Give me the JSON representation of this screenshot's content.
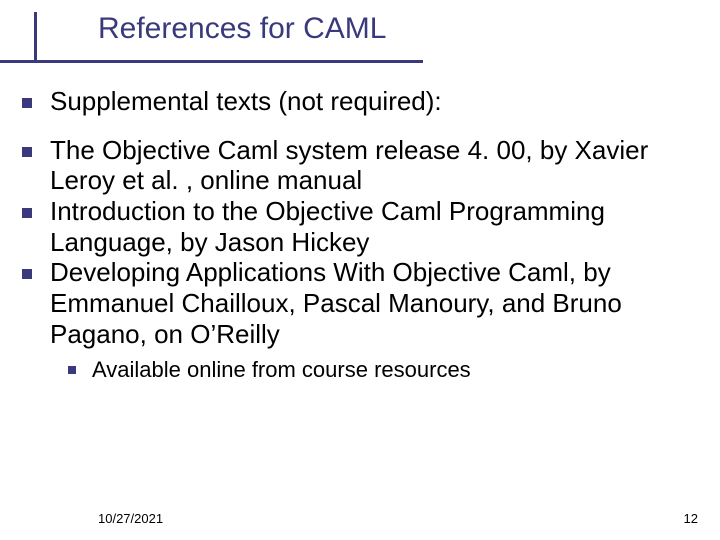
{
  "title": "References for CAML",
  "bullets": [
    "Supplemental texts (not required):",
    "The Objective Caml system release 4. 00, by Xavier Leroy et al. , online manual",
    "Introduction to the Objective Caml Programming Language, by Jason Hickey",
    "Developing Applications With Objective Caml, by Emmanuel Chailloux, Pascal Manoury, and Bruno Pagano, on O’Reilly"
  ],
  "subbullet": "Available online from course resources",
  "footer": {
    "date": "10/27/2021",
    "page": "12"
  }
}
